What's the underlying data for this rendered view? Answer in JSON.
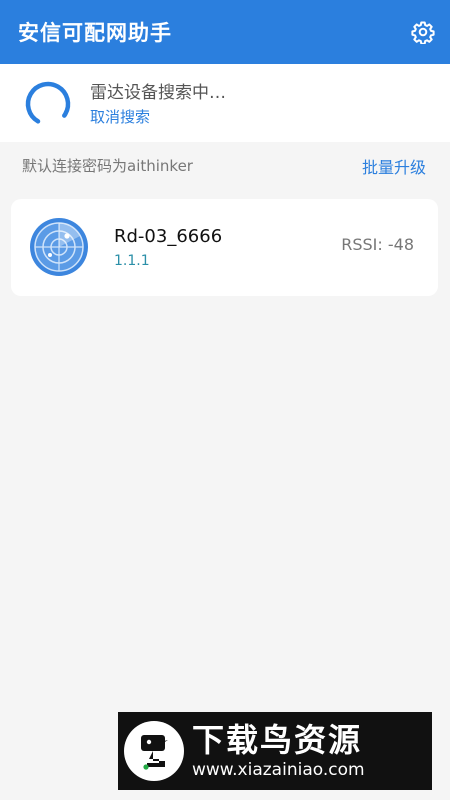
{
  "app": {
    "title": "安信可配网助手",
    "settings_icon": "gear-icon",
    "accent_color": "#2b7fde"
  },
  "search": {
    "status_text": "雷达设备搜索中…",
    "cancel_label": "取消搜索",
    "spinner_icon": "loading-spinner-icon"
  },
  "info": {
    "password_hint": "默认连接密码为aithinker",
    "batch_upgrade_label": "批量升级"
  },
  "devices": [
    {
      "name": "Rd-03_6666",
      "version": "1.1.1",
      "rssi": "RSSI: -48",
      "icon": "radar-icon"
    }
  ],
  "watermark": {
    "title": "下载鸟资源",
    "url": "www.xiazainiao.com"
  }
}
